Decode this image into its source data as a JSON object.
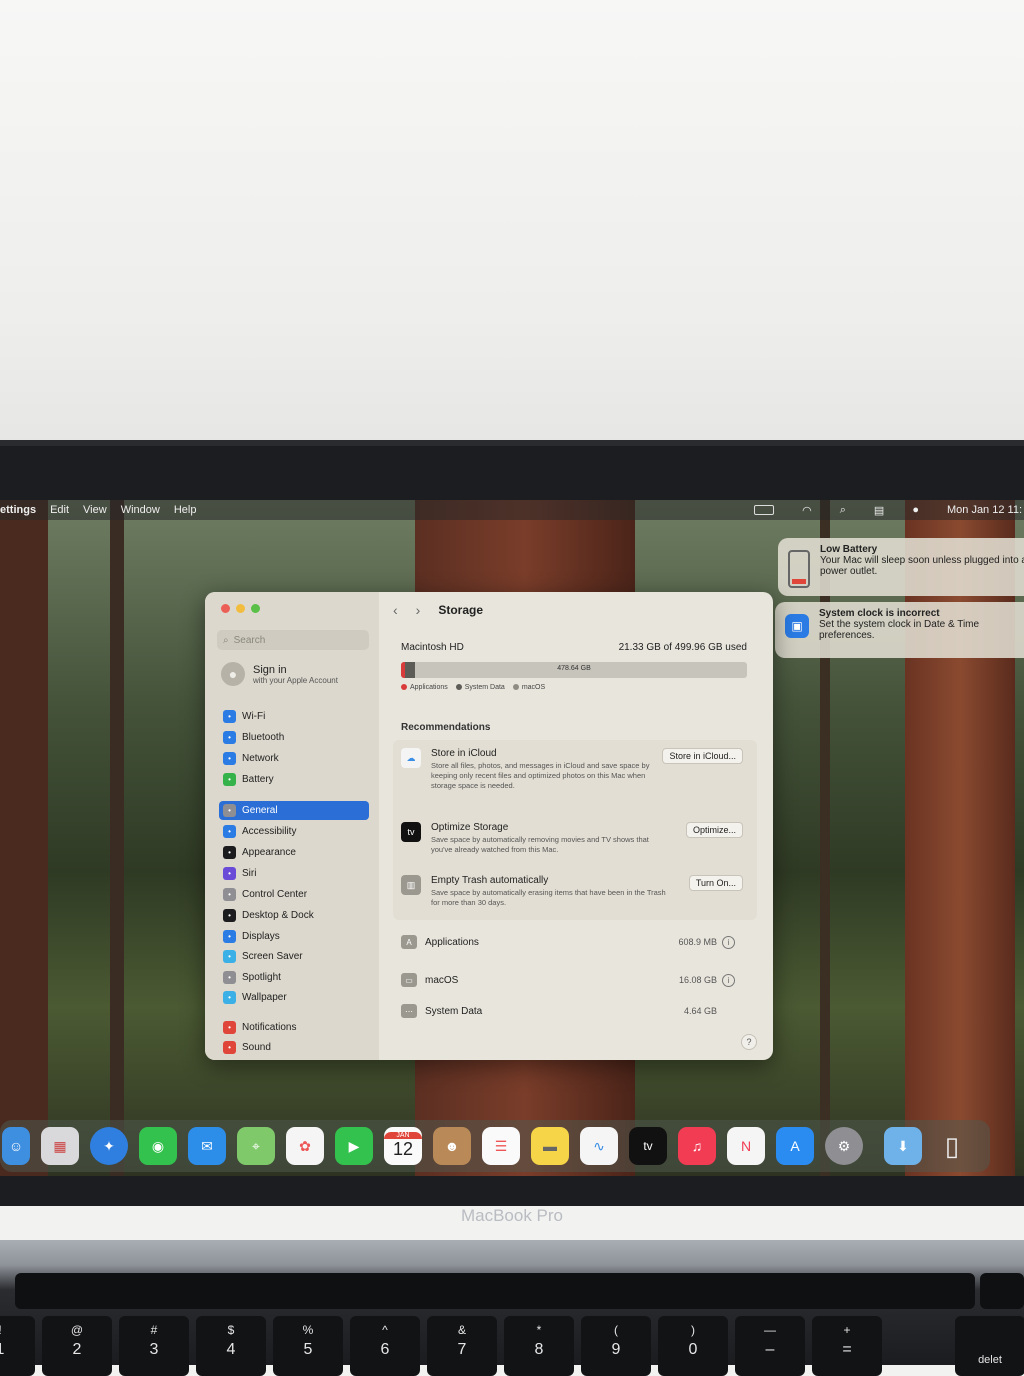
{
  "menubar": {
    "app": "ettings",
    "items": [
      "Edit",
      "View",
      "Window",
      "Help"
    ],
    "clock": "Mon Jan 12  11:"
  },
  "notifications": [
    {
      "title": "Low Battery",
      "body": "Your Mac will sleep soon unless plugged into a power outlet."
    },
    {
      "title": "System clock is incorrect",
      "body": "Set the system clock in Date & Time preferences."
    }
  ],
  "sidebar": {
    "search_placeholder": "Search",
    "sign_in_title": "Sign in",
    "sign_in_sub": "with your Apple Account",
    "items": [
      {
        "label": "Wi-Fi",
        "color": "#2a7be4"
      },
      {
        "label": "Bluetooth",
        "color": "#2a7be4"
      },
      {
        "label": "Network",
        "color": "#2a7be4"
      },
      {
        "label": "Battery",
        "color": "#35b24a"
      },
      {
        "label": "General",
        "color": "#8e8e93"
      },
      {
        "label": "Accessibility",
        "color": "#2a7be4"
      },
      {
        "label": "Appearance",
        "color": "#1c1c1e"
      },
      {
        "label": "Siri",
        "color": "#6a4bd8"
      },
      {
        "label": "Control Center",
        "color": "#8e8e93"
      },
      {
        "label": "Desktop & Dock",
        "color": "#1c1c1e"
      },
      {
        "label": "Displays",
        "color": "#2a7be4"
      },
      {
        "label": "Screen Saver",
        "color": "#3ab0e6"
      },
      {
        "label": "Spotlight",
        "color": "#8e8e93"
      },
      {
        "label": "Wallpaper",
        "color": "#3ab0e6"
      },
      {
        "label": "Notifications",
        "color": "#e0453a"
      },
      {
        "label": "Sound",
        "color": "#e0453a"
      }
    ],
    "selected": "General"
  },
  "storage": {
    "nav_title": "Storage",
    "disk_name": "Macintosh HD",
    "used_text": "21.33 GB of 499.96 GB used",
    "available_label": "478.64 GB",
    "legend": [
      "Applications",
      "System Data",
      "macOS"
    ],
    "recommendations_header": "Recommendations",
    "recommendations": [
      {
        "title": "Store in iCloud",
        "desc": "Store all files, photos, and messages in iCloud and save space by keeping only recent files and optimized photos on this Mac when storage space is needed.",
        "button": "Store in iCloud..."
      },
      {
        "title": "Optimize Storage",
        "desc": "Save space by automatically removing movies and TV shows that you've already watched from this Mac.",
        "button": "Optimize..."
      },
      {
        "title": "Empty Trash automatically",
        "desc": "Save space by automatically erasing items that have been in the Trash for more than 30 days.",
        "button": "Turn On..."
      }
    ],
    "categories": [
      {
        "name": "Applications",
        "size": "608.9 MB"
      },
      {
        "name": "macOS",
        "size": "16.08 GB"
      },
      {
        "name": "System Data",
        "size": "4.64 GB"
      }
    ],
    "help": "?"
  },
  "dock": {
    "calendar_month": "JAN",
    "calendar_day": "12",
    "tv_label": "tv"
  },
  "laptop": {
    "brand": "MacBook Pro",
    "keys": [
      {
        "sym": "!",
        "num": "1"
      },
      {
        "sym": "@",
        "num": "2"
      },
      {
        "sym": "#",
        "num": "3"
      },
      {
        "sym": "$",
        "num": "4"
      },
      {
        "sym": "%",
        "num": "5"
      },
      {
        "sym": "^",
        "num": "6"
      },
      {
        "sym": "&",
        "num": "7"
      },
      {
        "sym": "*",
        "num": "8"
      },
      {
        "sym": "(",
        "num": "9"
      },
      {
        "sym": ")",
        "num": "0"
      },
      {
        "sym": "—",
        "num": "–"
      },
      {
        "sym": "+",
        "num": "="
      }
    ],
    "delete_key": "delet"
  }
}
